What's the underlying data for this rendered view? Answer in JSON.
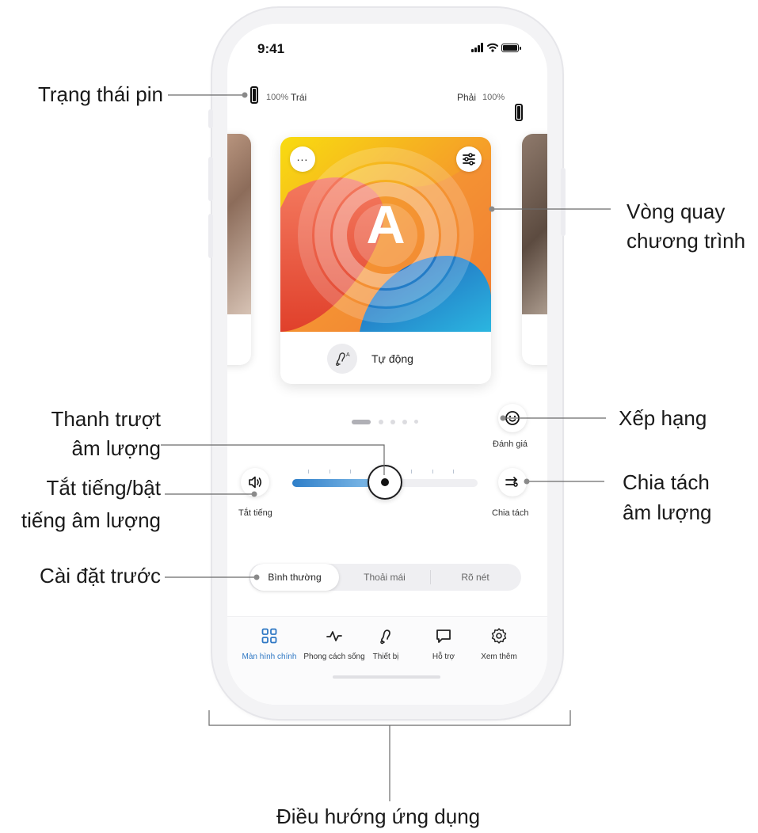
{
  "status_bar": {
    "time": "9:41"
  },
  "battery": {
    "left": {
      "percent": "100%",
      "side": "Trái"
    },
    "right": {
      "percent": "100%",
      "side": "Phải"
    }
  },
  "program_card": {
    "letter": "A",
    "name": "Tự động",
    "more_icon": "ellipsis-icon",
    "settings_icon": "sliders-icon",
    "program_icon": "hearing-aid-icon"
  },
  "carousel": {
    "page_count": 5,
    "active_page": 1
  },
  "controls": {
    "mute_label": "Tắt tiếng",
    "rating_label": "Đánh giá",
    "split_label": "Chia tách"
  },
  "volume": {
    "level": 0.5
  },
  "presets": {
    "items": [
      "Bình thường",
      "Thoải mái",
      "Rõ nét"
    ],
    "selected": "Bình thường"
  },
  "nav": {
    "items": [
      {
        "label": "Màn hình chính",
        "icon": "grid-icon",
        "active": true
      },
      {
        "label": "Phong cách sống",
        "icon": "activity-icon",
        "active": false
      },
      {
        "label": "Thiết bị",
        "icon": "hearing-aid-icon",
        "active": false
      },
      {
        "label": "Hỗ trợ",
        "icon": "chat-icon",
        "active": false
      },
      {
        "label": "Xem thêm",
        "icon": "gear-icon",
        "active": false
      }
    ]
  },
  "callouts": {
    "battery_status": "Trạng thái pin",
    "program_carousel_line1": "Vòng quay",
    "program_carousel_line2": "chương trình",
    "rating": "Xếp hạng",
    "volume_slider_line1": "Thanh trượt",
    "volume_slider_line2": "âm lượng",
    "mute_line1": "Tắt tiếng/bật",
    "mute_line2": "tiếng âm lượng",
    "split_line1": "Chia tách",
    "split_line2": "âm lượng",
    "presets": "Cài đặt trước",
    "app_navigation": "Điều hướng ứng dụng"
  },
  "colors": {
    "accent_blue": "#2f78c4",
    "slider_fill_start": "#2f7fc9",
    "slider_fill_end": "#8cc3ec",
    "card_yellow": "#f7d20e",
    "card_orange": "#f06a28",
    "card_blue": "#27a6dc"
  }
}
